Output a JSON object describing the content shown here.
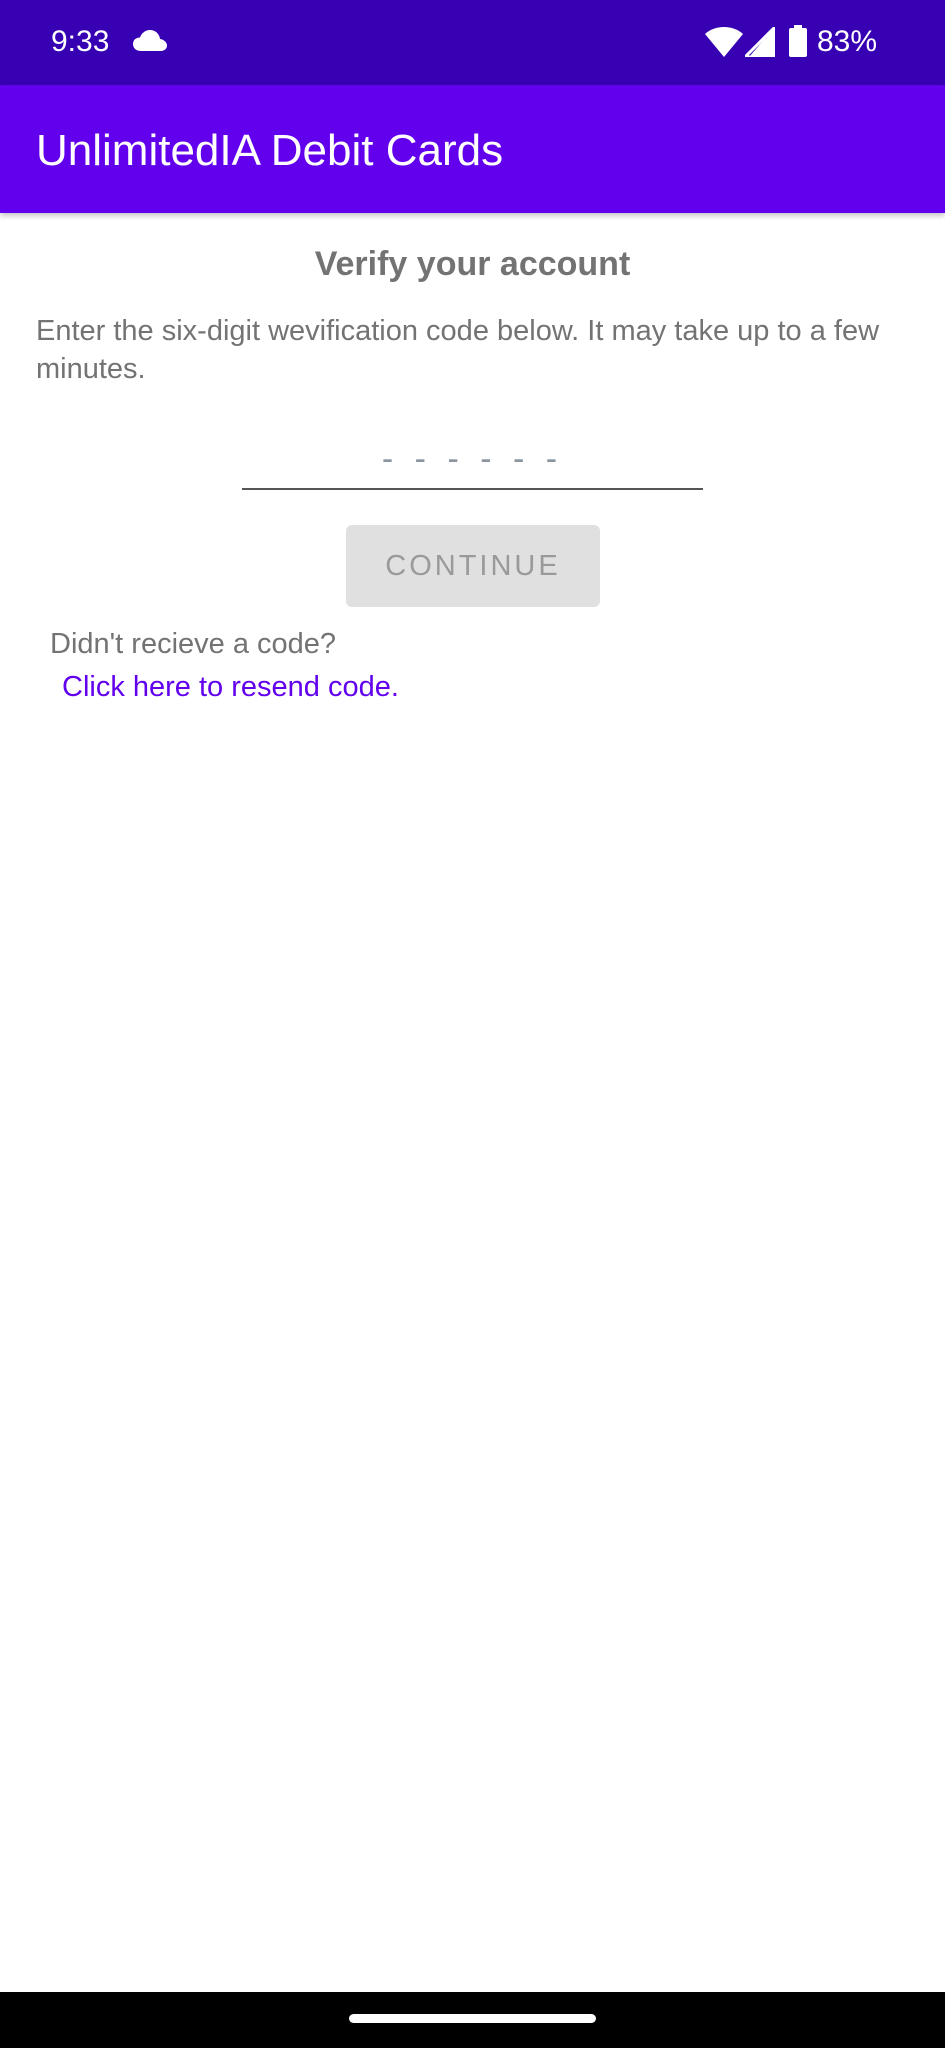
{
  "status_bar": {
    "time": "9:33",
    "battery": "83%",
    "icons": [
      "cloud-icon",
      "wifi-icon",
      "signal-icon",
      "battery-icon"
    ]
  },
  "app_bar": {
    "title": "UnlimitedIA Debit Cards"
  },
  "verify": {
    "title": "Verify your account",
    "instructions": "Enter the six-digit wevification code below. It may take up to a few minutes.",
    "code_placeholder": "------",
    "code_value": "",
    "continue_label": "CONTINUE"
  },
  "resend": {
    "prompt": "Didn't recieve a code?",
    "link": "Click here to resend code."
  },
  "colors": {
    "status_bar": "#3700b3",
    "primary": "#6200ee",
    "text_secondary": "#737373",
    "button_disabled": "#e0e0e0"
  }
}
